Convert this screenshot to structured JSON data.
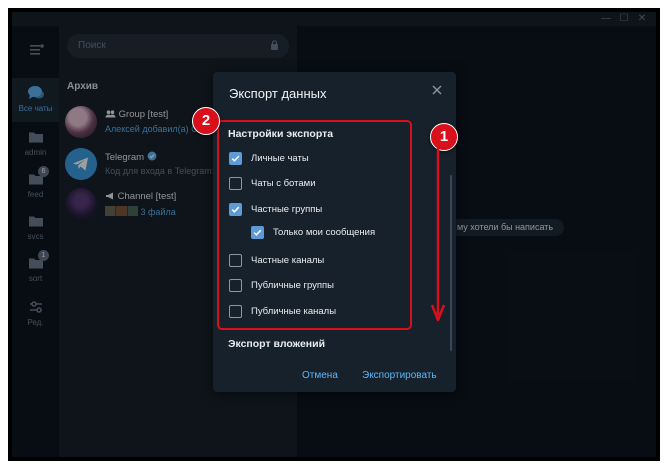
{
  "window": {
    "controls": {
      "minimize": "—",
      "maximize": "☐",
      "close": "✕"
    }
  },
  "folders": [
    {
      "label": "Все чаты",
      "icon": "chat-bubbles-icon",
      "active": true,
      "badge": ""
    },
    {
      "label": "admin",
      "icon": "folder-icon",
      "active": false,
      "badge": ""
    },
    {
      "label": "feed",
      "icon": "folder-icon",
      "active": false,
      "badge": "6"
    },
    {
      "label": "svcs",
      "icon": "folder-icon",
      "active": false,
      "badge": ""
    },
    {
      "label": "sort",
      "icon": "folder-icon",
      "active": false,
      "badge": "1"
    },
    {
      "label": "Ред.",
      "icon": "sliders-icon",
      "active": false,
      "badge": ""
    }
  ],
  "search": {
    "placeholder": "Поиск"
  },
  "chat_list": {
    "section_title": "Архив",
    "chats": [
      {
        "name": "Group [test]",
        "preview_highlight": "Алексей добавил(а) Се",
        "preview": ""
      },
      {
        "name": "Telegram",
        "preview_highlight": "",
        "preview": "Код для входа в Telegram:"
      },
      {
        "name": "Channel [test]",
        "preview_highlight": "3 файла",
        "preview": ""
      }
    ]
  },
  "main": {
    "message_fragment": "му хотели бы написать"
  },
  "dialog": {
    "title": "Экспорт данных",
    "section_settings": "Настройки экспорта",
    "options": [
      {
        "label": "Личные чаты",
        "checked": true,
        "indent": false
      },
      {
        "label": "Чаты с ботами",
        "checked": false,
        "indent": false
      },
      {
        "label": "Частные группы",
        "checked": true,
        "indent": false
      },
      {
        "label": "Только мои сообщения",
        "checked": true,
        "indent": true
      },
      {
        "label": "Частные каналы",
        "checked": false,
        "indent": false
      },
      {
        "label": "Публичные группы",
        "checked": false,
        "indent": false
      },
      {
        "label": "Публичные каналы",
        "checked": false,
        "indent": false
      }
    ],
    "section_attachments": "Экспорт вложений",
    "cancel_label": "Отмена",
    "export_label": "Экспортировать"
  },
  "annotations": {
    "marker_1": "1",
    "marker_2": "2",
    "color": "#d8101b"
  },
  "colors": {
    "accent": "#5eb5f7",
    "checkbox": "#5e9ad6",
    "background": "#0e1621",
    "panel": "#17212b"
  }
}
